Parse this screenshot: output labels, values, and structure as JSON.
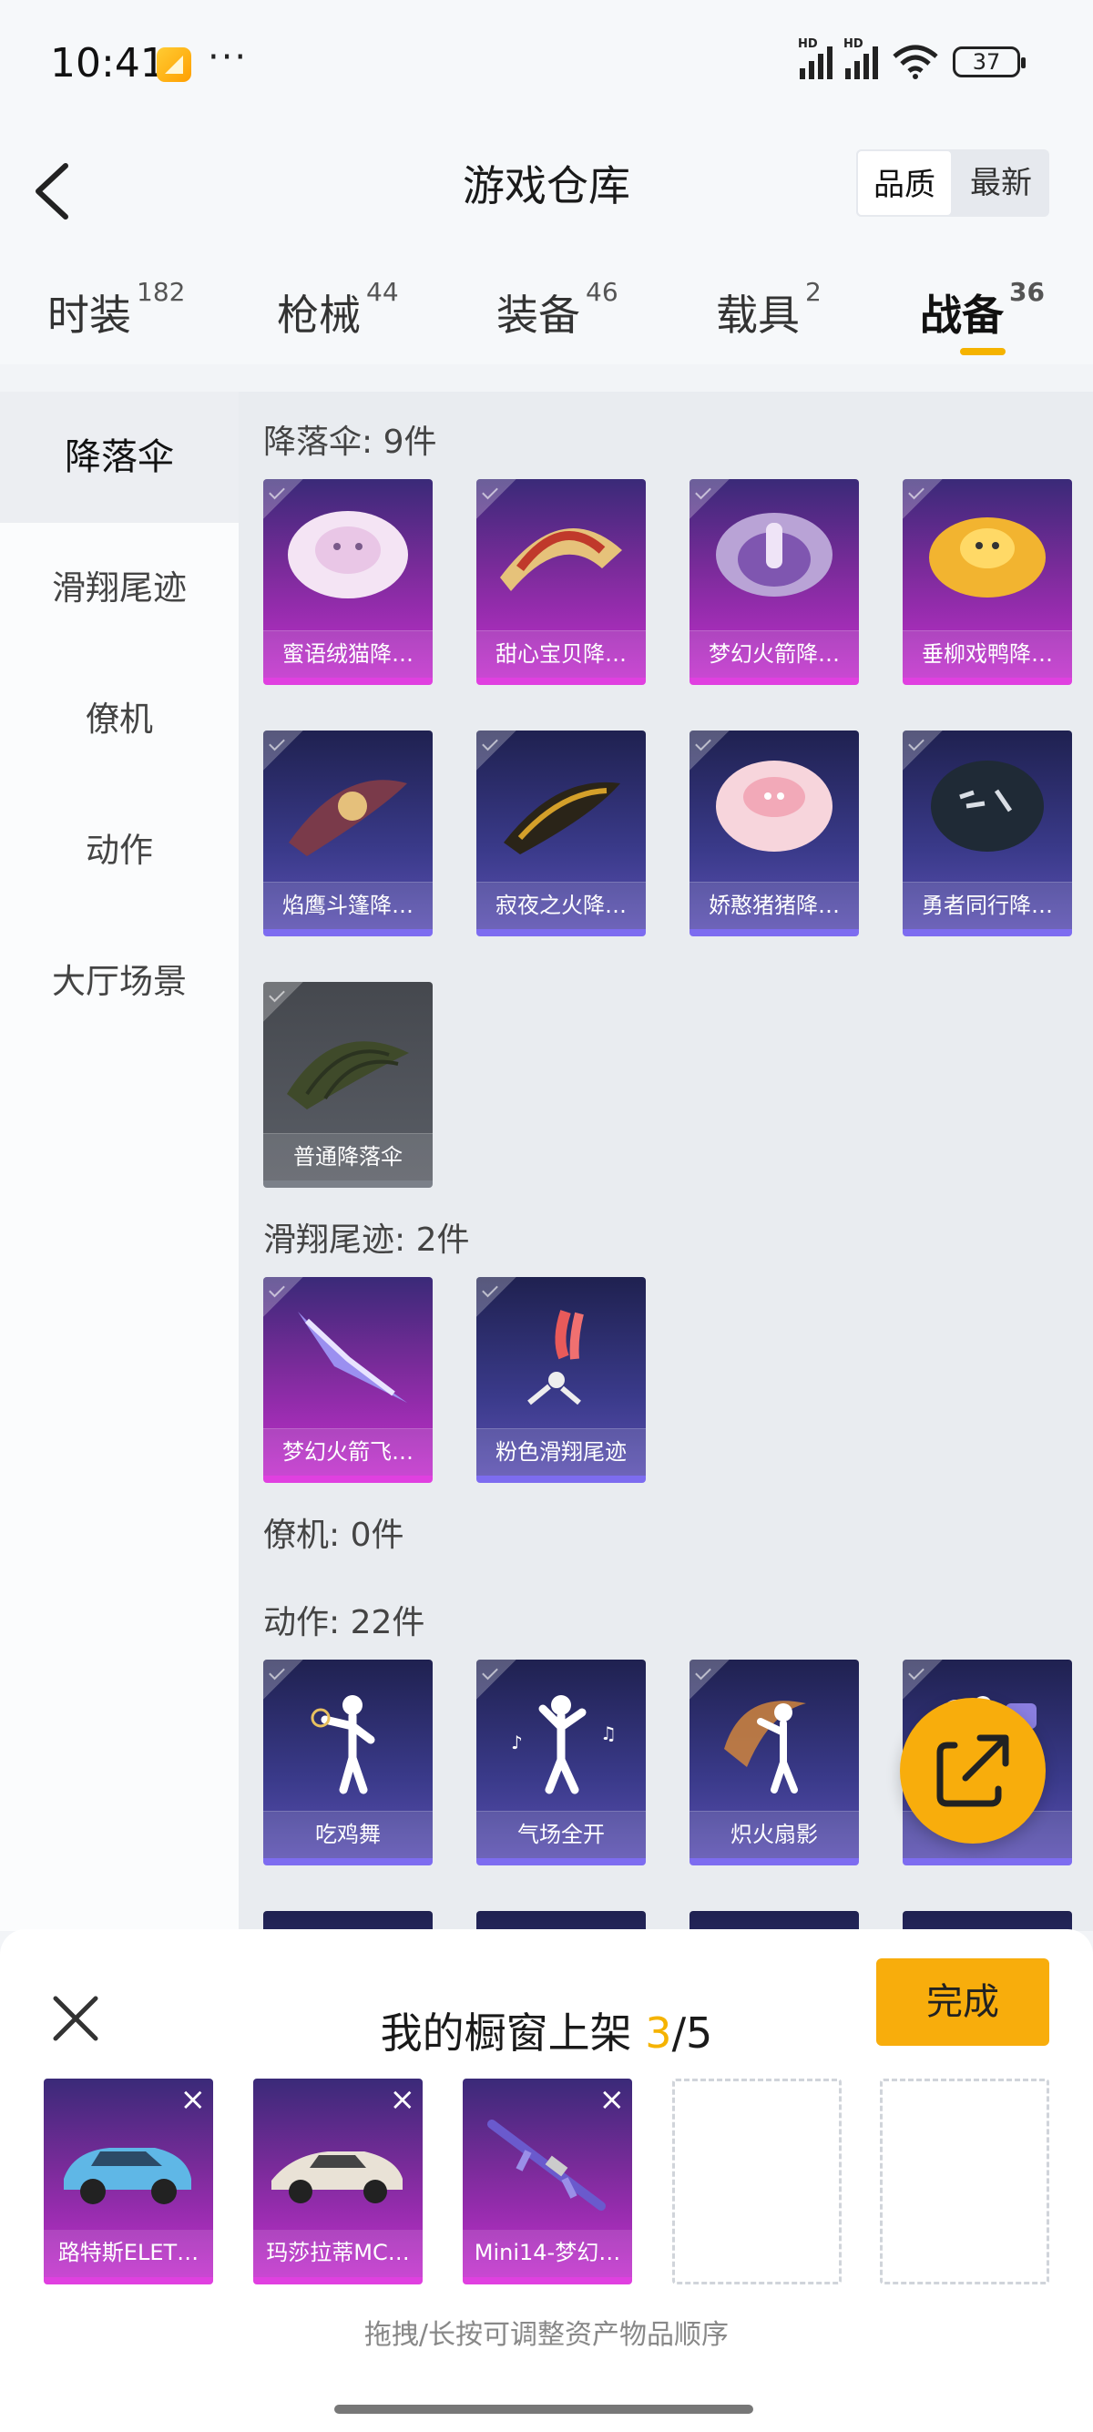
{
  "status": {
    "time": "10:41",
    "more": "···",
    "battery": "37"
  },
  "header": {
    "title": "游戏仓库",
    "sort": [
      "品质",
      "最新"
    ],
    "tabs": [
      {
        "label": "时装",
        "count": "182"
      },
      {
        "label": "枪械",
        "count": "44"
      },
      {
        "label": "装备",
        "count": "46"
      },
      {
        "label": "载具",
        "count": "2"
      },
      {
        "label": "战备",
        "count": "36"
      }
    ]
  },
  "sidebar": {
    "items": [
      {
        "label": "降落伞"
      },
      {
        "label": "滑翔尾迹"
      },
      {
        "label": "僚机"
      },
      {
        "label": "动作"
      },
      {
        "label": "大厅场景"
      }
    ]
  },
  "sections": {
    "parachute": {
      "title": "降落伞: 9件",
      "items": [
        {
          "label": "蜜语绒猫降…"
        },
        {
          "label": "甜心宝贝降…"
        },
        {
          "label": "梦幻火箭降…"
        },
        {
          "label": "垂柳戏鸭降…"
        },
        {
          "label": "焰鹰斗篷降…"
        },
        {
          "label": "寂夜之火降…"
        },
        {
          "label": "娇憨猪猪降…"
        },
        {
          "label": "勇者同行降…"
        },
        {
          "label": "普通降落伞"
        }
      ]
    },
    "trail": {
      "title": "滑翔尾迹: 2件",
      "items": [
        {
          "label": "梦幻火箭飞…"
        },
        {
          "label": "粉色滑翔尾迹"
        }
      ]
    },
    "wingman": {
      "title": "僚机: 0件"
    },
    "emote": {
      "title": "动作: 22件",
      "items": [
        {
          "label": "吃鸡舞"
        },
        {
          "label": "气场全开"
        },
        {
          "label": "炽火扇影"
        },
        {
          "label": ""
        }
      ]
    }
  },
  "panel": {
    "title_prefix": "我的橱窗上架 ",
    "count": "3",
    "total": "/5",
    "done_label": "完成",
    "slots": [
      {
        "label": "路特斯ELET…"
      },
      {
        "label": "玛莎拉蒂MC…"
      },
      {
        "label": "Mini14-梦幻…"
      }
    ],
    "hint": "拖拽/长按可调整资产物品顺序"
  }
}
